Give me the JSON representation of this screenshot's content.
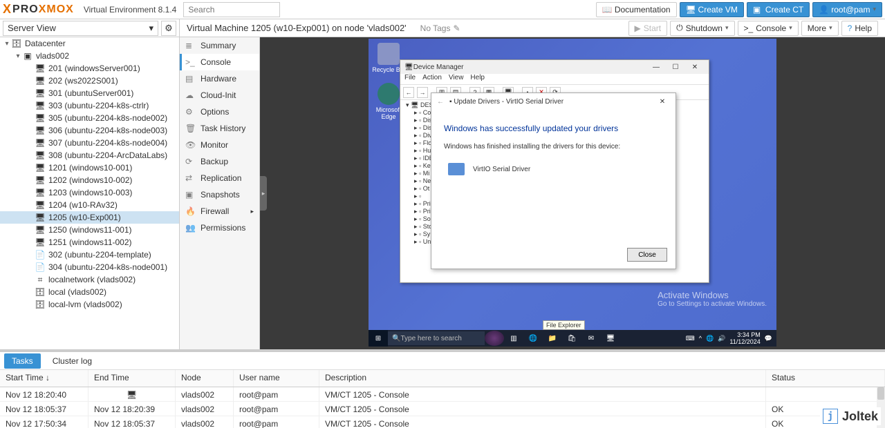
{
  "brand": {
    "x": "X",
    "pre": "PRO",
    "mid": "XMO",
    "post": "X",
    "product": "Virtual Environment 8.1.4"
  },
  "search_placeholder": "Search",
  "header_buttons": {
    "docs": "Documentation",
    "createvm": "Create VM",
    "createct": "Create CT",
    "user": "root@pam"
  },
  "view_selector": "Server View",
  "breadcrumb": "Virtual Machine 1205 (w10-Exp001) on node 'vlads002'",
  "notags": "No Tags",
  "vm_actions": {
    "start": "Start",
    "shutdown": "Shutdown",
    "console": "Console",
    "more": "More",
    "help": "Help"
  },
  "tree": [
    {
      "label": "Datacenter",
      "indent": 0,
      "icon": "server",
      "toggle": "▾"
    },
    {
      "label": "vlads002",
      "indent": 1,
      "icon": "node",
      "toggle": "▾"
    },
    {
      "label": "201 (windowsServer001)",
      "indent": 2,
      "icon": "vm"
    },
    {
      "label": "202 (ws2022S001)",
      "indent": 2,
      "icon": "vm"
    },
    {
      "label": "301 (ubuntuServer001)",
      "indent": 2,
      "icon": "vm"
    },
    {
      "label": "303 (ubuntu-2204-k8s-ctrlr)",
      "indent": 2,
      "icon": "vm"
    },
    {
      "label": "305 (ubuntu-2204-k8s-node002)",
      "indent": 2,
      "icon": "vm"
    },
    {
      "label": "306 (ubuntu-2204-k8s-node003)",
      "indent": 2,
      "icon": "vm"
    },
    {
      "label": "307 (ubuntu-2204-k8s-node004)",
      "indent": 2,
      "icon": "vm"
    },
    {
      "label": "308 (ubuntu-2204-ArcDataLabs)",
      "indent": 2,
      "icon": "vm"
    },
    {
      "label": "1201 (windows10-001)",
      "indent": 2,
      "icon": "vm"
    },
    {
      "label": "1202 (windows10-002)",
      "indent": 2,
      "icon": "vm"
    },
    {
      "label": "1203 (windows10-003)",
      "indent": 2,
      "icon": "vm"
    },
    {
      "label": "1204 (w10-RAv32)",
      "indent": 2,
      "icon": "vm"
    },
    {
      "label": "1205 (w10-Exp001)",
      "indent": 2,
      "icon": "vm",
      "selected": true
    },
    {
      "label": "1250 (windows11-001)",
      "indent": 2,
      "icon": "vm"
    },
    {
      "label": "1251 (windows11-002)",
      "indent": 2,
      "icon": "vm"
    },
    {
      "label": "302 (ubuntu-2204-template)",
      "indent": 2,
      "icon": "tmpl"
    },
    {
      "label": "304 (ubuntu-2204-k8s-node001)",
      "indent": 2,
      "icon": "tmpl"
    },
    {
      "label": "localnetwork (vlads002)",
      "indent": 2,
      "icon": "net"
    },
    {
      "label": "local (vlads002)",
      "indent": 2,
      "icon": "disk"
    },
    {
      "label": "local-lvm (vlads002)",
      "indent": 2,
      "icon": "disk"
    }
  ],
  "inner_nav": [
    {
      "label": "Summary",
      "icon": "≣"
    },
    {
      "label": "Console",
      "icon": ">_",
      "active": true
    },
    {
      "label": "Hardware",
      "icon": "▤"
    },
    {
      "label": "Cloud-Init",
      "icon": "☁"
    },
    {
      "label": "Options",
      "icon": "⚙"
    },
    {
      "label": "Task History",
      "icon": "🗑"
    },
    {
      "label": "Monitor",
      "icon": "👁"
    },
    {
      "label": "Backup",
      "icon": "⟳"
    },
    {
      "label": "Replication",
      "icon": "⇄"
    },
    {
      "label": "Snapshots",
      "icon": "▣"
    },
    {
      "label": "Firewall",
      "icon": "🔥",
      "arrow": true
    },
    {
      "label": "Permissions",
      "icon": "👥"
    }
  ],
  "desktop_icons": {
    "recycle": "Recycle Bin",
    "edge": "Microsoft Edge"
  },
  "devmgr": {
    "title": "Device Manager",
    "menus": [
      "File",
      "Action",
      "View",
      "Help"
    ],
    "root": "DESKT…",
    "rows": [
      "Co",
      "Dis",
      "Dis",
      "Div",
      "Flo",
      "Hu",
      "IDE",
      "Ke",
      "Mi",
      "Ne",
      "Ot",
      "",
      "Pri",
      "Pri",
      "So",
      "Sto",
      "Sy",
      "Un"
    ]
  },
  "dialog": {
    "title": "Update Drivers - VirtIO Serial Driver",
    "heading": "Windows has successfully updated your drivers",
    "body": "Windows has finished installing the drivers for this device:",
    "driver": "VirtIO Serial Driver",
    "close": "Close"
  },
  "taskbar": {
    "search": "Type here to search",
    "tooltip": "File Explorer",
    "time": "3:34 PM",
    "date": "11/12/2024"
  },
  "watermark": {
    "h": "Activate Windows",
    "s": "Go to Settings to activate Windows."
  },
  "log": {
    "tabs": {
      "tasks": "Tasks",
      "cluster": "Cluster log"
    },
    "cols": {
      "start": "Start Time",
      "end": "End Time",
      "node": "Node",
      "user": "User name",
      "desc": "Description",
      "status": "Status"
    },
    "rows": [
      {
        "start": "Nov 12 18:20:40",
        "end_icon": true,
        "node": "vlads002",
        "user": "root@pam",
        "desc": "VM/CT 1205 - Console",
        "status": ""
      },
      {
        "start": "Nov 12 18:05:37",
        "end": "Nov 12 18:20:39",
        "node": "vlads002",
        "user": "root@pam",
        "desc": "VM/CT 1205 - Console",
        "status": "OK"
      },
      {
        "start": "Nov 12 17:50:34",
        "end": "Nov 12 18:05:37",
        "node": "vlads002",
        "user": "root@pam",
        "desc": "VM/CT 1205 - Console",
        "status": "OK"
      }
    ]
  },
  "joltek": "Joltek"
}
